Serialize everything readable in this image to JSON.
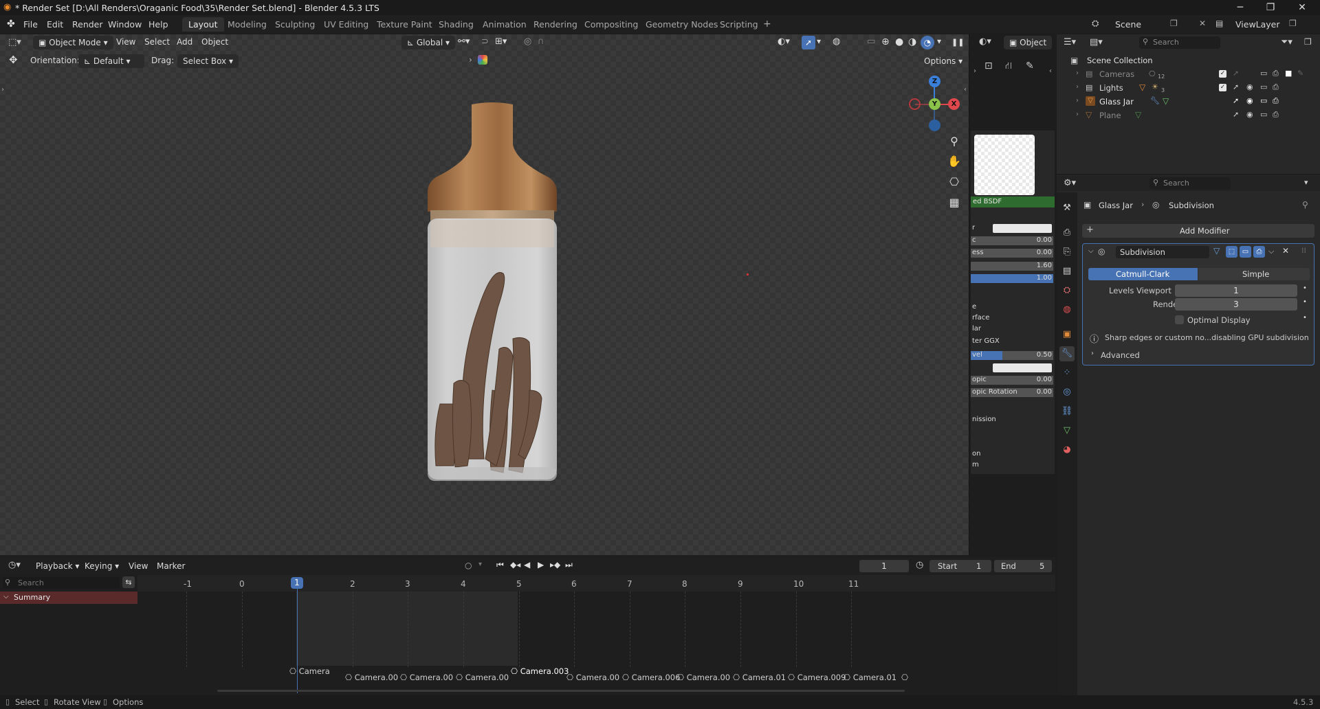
{
  "window": {
    "title": "* Render Set [D:\\All Renders\\Oraganic Food\\35\\Render Set.blend] - Blender 4.5.3 LTS",
    "minimize": "─",
    "maximize": "❐",
    "close": "✕"
  },
  "menu": [
    "File",
    "Edit",
    "Render",
    "Window",
    "Help"
  ],
  "workspaces": [
    "Layout",
    "Modeling",
    "Sculpting",
    "UV Editing",
    "Texture Paint",
    "Shading",
    "Animation",
    "Rendering",
    "Compositing",
    "Geometry Nodes",
    "Scripting"
  ],
  "active_workspace": "Layout",
  "scene": {
    "label": "Scene",
    "view_layer": "ViewLayer"
  },
  "viewport": {
    "mode": "Object Mode",
    "menus": [
      "View",
      "Select",
      "Add",
      "Object"
    ],
    "transform_orientation": "Global",
    "orientation_label": "Orientation:",
    "orientation_value": "Default",
    "drag_label": "Drag:",
    "drag_value": "Select Box",
    "options": "Options",
    "gizmo": {
      "z": "Z",
      "y": "Y",
      "x": "X"
    }
  },
  "shader_panel": {
    "header": "Object",
    "node": "ed BSDF",
    "rows": [
      {
        "label": "r",
        "value": ""
      },
      {
        "label": "c",
        "value": "0.00"
      },
      {
        "label": "ess",
        "value": "0.00"
      },
      {
        "label": "",
        "value": "1.60"
      },
      {
        "label": "",
        "value": "1.00"
      },
      {
        "label": "e",
        "value": ""
      },
      {
        "label": "rface",
        "value": ""
      },
      {
        "label": "lar",
        "value": ""
      },
      {
        "label": "ter GGX",
        "value": ""
      },
      {
        "label": "vel",
        "value": "0.50"
      },
      {
        "label": "",
        "value": ""
      },
      {
        "label": "opic",
        "value": "0.00"
      },
      {
        "label": "opic Rotation",
        "value": "0.00"
      },
      {
        "label": "nission",
        "value": ""
      },
      {
        "label": "on",
        "value": ""
      },
      {
        "label": "m",
        "value": ""
      }
    ]
  },
  "outliner": {
    "search_placeholder": "Search",
    "root": "Scene Collection",
    "items": [
      {
        "name": "Cameras",
        "badge": "12"
      },
      {
        "name": "Lights",
        "badge": "3"
      },
      {
        "name": "Glass Jar",
        "badge": ""
      },
      {
        "name": "Plane",
        "badge": ""
      }
    ]
  },
  "properties": {
    "search_placeholder": "Search",
    "breadcrumb_object": "Glass Jar",
    "breadcrumb_modifier": "Subdivision",
    "add_modifier": "Add Modifier",
    "modifier_name": "Subdivision",
    "algo_options": [
      "Catmull-Clark",
      "Simple"
    ],
    "levels_viewport_label": "Levels Viewport",
    "levels_viewport": "1",
    "render_label": "Render",
    "render_levels": "3",
    "optimal_display": "Optimal Display",
    "warning": "Sharp edges or custom no...disabling GPU subdivision",
    "advanced": "Advanced"
  },
  "timeline": {
    "menus": [
      "Playback",
      "Keying",
      "View",
      "Marker"
    ],
    "current_frame": "1",
    "start_label": "Start",
    "start": "1",
    "end_label": "End",
    "end": "5",
    "search_placeholder": "Search",
    "summary": "Summary",
    "ticks": [
      "-1",
      "0",
      "1",
      "2",
      "3",
      "4",
      "5",
      "6",
      "7",
      "8",
      "9",
      "10",
      "11"
    ],
    "markers": [
      "Camera",
      "Camera.00",
      "Camera.00",
      "Camera.00",
      "Camera.003",
      "Camera.00",
      "Camera.006",
      "Camera.00",
      "Camera.01",
      "Camera.009",
      "Camera.01"
    ]
  },
  "status": {
    "select": "Select",
    "rotate": "Rotate View",
    "options": "Options",
    "version": "4.5.3"
  },
  "colors": {
    "accent_blue": "#4772b3",
    "node_green": "#2e6b2e",
    "gizmo_x": "#e0474c",
    "gizmo_y": "#8bc34a",
    "gizmo_z": "#3a7fd9"
  }
}
